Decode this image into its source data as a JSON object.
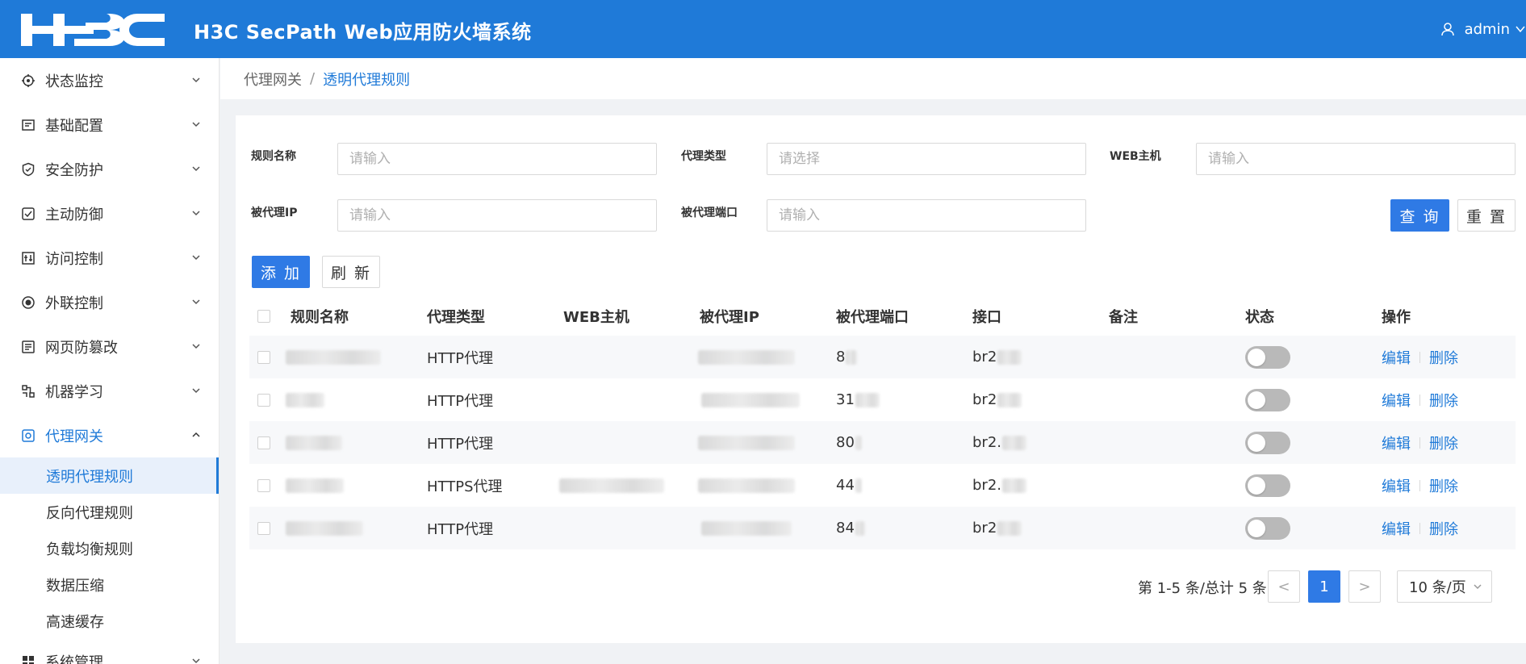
{
  "header": {
    "logo_text": "H3C",
    "title": "H3C SecPath Web应用防火墙系统",
    "user": "admin",
    "brand_color": "#1f7ad8"
  },
  "sidebar": {
    "items": [
      {
        "label": "状态监控",
        "icon": "dashboard-icon",
        "expanded": false
      },
      {
        "label": "基础配置",
        "icon": "config-icon",
        "expanded": false
      },
      {
        "label": "安全防护",
        "icon": "shield-icon",
        "expanded": false
      },
      {
        "label": "主动防御",
        "icon": "defense-icon",
        "expanded": false
      },
      {
        "label": "访问控制",
        "icon": "access-control-icon",
        "expanded": false
      },
      {
        "label": "外联控制",
        "icon": "outbound-icon",
        "expanded": false
      },
      {
        "label": "网页防篡改",
        "icon": "webpage-icon",
        "expanded": false
      },
      {
        "label": "机器学习",
        "icon": "ml-icon",
        "expanded": false
      },
      {
        "label": "代理网关",
        "icon": "proxy-icon",
        "expanded": true
      },
      {
        "label": "系统管理",
        "icon": "system-icon",
        "expanded": false
      }
    ],
    "sub_items": [
      {
        "label": "透明代理规则",
        "active": true
      },
      {
        "label": "反向代理规则",
        "active": false
      },
      {
        "label": "负载均衡规则",
        "active": false
      },
      {
        "label": "数据压缩",
        "active": false
      },
      {
        "label": "高速缓存",
        "active": false
      }
    ]
  },
  "breadcrumb": {
    "parent": "代理网关",
    "separator": "/",
    "current": "透明代理规则"
  },
  "filters": {
    "rule_name": {
      "label": "规则名称",
      "placeholder": "请输入"
    },
    "proxy_type": {
      "label": "代理类型",
      "placeholder": "请选择"
    },
    "web_host": {
      "label": "WEB主机",
      "placeholder": "请输入"
    },
    "proxied_ip": {
      "label": "被代理IP",
      "placeholder": "请输入"
    },
    "proxied_port": {
      "label": "被代理端口",
      "placeholder": "请输入"
    },
    "query_label": "查 询",
    "reset_label": "重 置"
  },
  "toolbar": {
    "add_label": "添 加",
    "refresh_label": "刷 新"
  },
  "table": {
    "columns": [
      "规则名称",
      "代理类型",
      "WEB主机",
      "被代理IP",
      "被代理端口",
      "接口",
      "备注",
      "状态",
      "操作"
    ],
    "rows": [
      {
        "type": "HTTP代理",
        "port": "8",
        "iface": "br2",
        "enabled": false
      },
      {
        "type": "HTTP代理",
        "port": "31",
        "iface": "br2",
        "enabled": false
      },
      {
        "type": "HTTP代理",
        "port": "80",
        "iface": "br2.",
        "enabled": false
      },
      {
        "type": "HTTPS代理",
        "port": "44",
        "iface": "br2.",
        "enabled": false
      },
      {
        "type": "HTTP代理",
        "port": "84",
        "iface": "br2",
        "enabled": false
      }
    ],
    "edit_label": "编辑",
    "delete_label": "删除"
  },
  "pagination": {
    "summary": "第 1-5 条/总计 5 条",
    "prev": "<",
    "current_page": "1",
    "next": ">",
    "page_size": "10 条/页"
  }
}
